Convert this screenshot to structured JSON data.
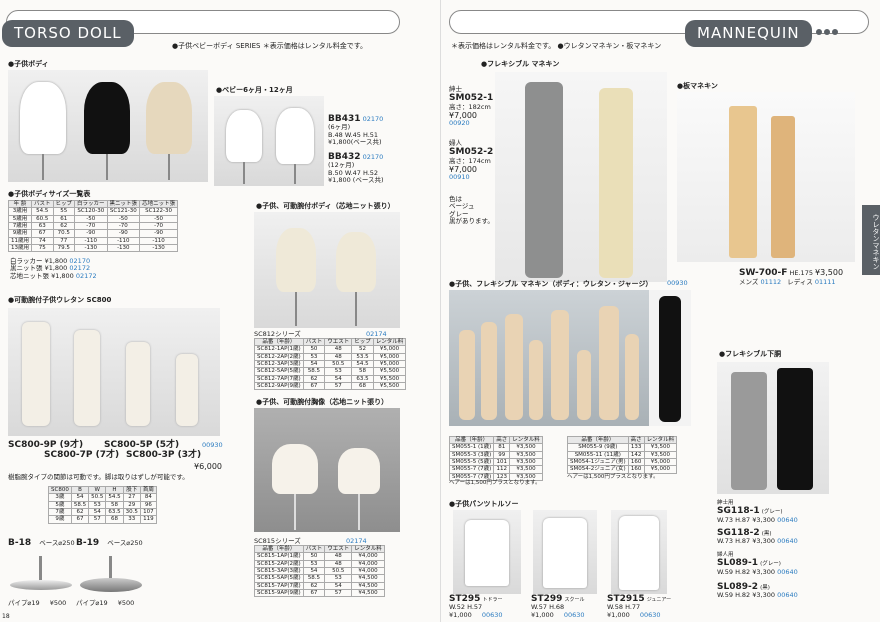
{
  "left": {
    "header": {
      "title": "TORSO DOLL",
      "subtitle": "●子供ベビーボディ SERIES ＊表示価格はレンタル料金です。"
    },
    "kids_body": {
      "title": "●子供ボディ"
    },
    "baby": {
      "title": "●ベビー6ヶ月・12ヶ月",
      "items": [
        {
          "code": "BB431",
          "num": "02170",
          "size": "(6ヶ月)",
          "dims": "B.48 W.45 H.51",
          "price": "¥1,800(ベース共)"
        },
        {
          "code": "BB432",
          "num": "02170",
          "size": "(12ヶ月)",
          "dims": "B.50 W.47 H.52",
          "price": "¥1,800 (ベース共)"
        }
      ]
    },
    "size_table": {
      "title": "●子供ボディサイズ一覧表",
      "headers": [
        "年 齢",
        "バスト",
        "ヒップ",
        "白ラッカー",
        "黒ニット張",
        "芯地ニット張"
      ],
      "rows": [
        [
          "3歳用",
          "54.5",
          "55",
          "SC120-30",
          "SC121-30",
          "SC122-30"
        ],
        [
          "5歳用",
          "60.5",
          "61",
          "-50",
          "-50",
          "-50"
        ],
        [
          "7歳用",
          "63",
          "62",
          "-70",
          "-70",
          "-70"
        ],
        [
          "9歳用",
          "67",
          "70.5",
          "-90",
          "-90",
          "-90"
        ],
        [
          "11歳用",
          "74",
          "77",
          "-110",
          "-110",
          "-110"
        ],
        [
          "13歳用",
          "75",
          "79.5",
          "-130",
          "-130",
          "-130"
        ]
      ],
      "prices": [
        {
          "label": "白ラッカー",
          "price": "¥1,800",
          "num": "02170"
        },
        {
          "label": "黒ニット張",
          "price": "¥1,800",
          "num": "02172"
        },
        {
          "label": "芯地ニット張",
          "price": "¥1,800",
          "num": "02172"
        }
      ]
    },
    "sc800": {
      "title": "●可動腕付子供ウレタン SC800",
      "labels": [
        "SC800-9P (9才)",
        "SC800-7P (7才)",
        "SC800-5P (5才)",
        "SC800-3P (3才)"
      ],
      "num": "00930",
      "price": "¥6,000",
      "note": "樹脂腕タイプの関節は可動です。脚は取りはずしが可能です。",
      "headers": [
        "SC800",
        "B",
        "W",
        "H",
        "股下",
        "首周"
      ],
      "rows": [
        [
          "3歳",
          "54",
          "50.5",
          "54.5",
          "27",
          "84"
        ],
        [
          "5歳",
          "58.5",
          "53",
          "58",
          "29",
          "96"
        ],
        [
          "7歳",
          "62",
          "54",
          "63.5",
          "30.5",
          "107"
        ],
        [
          "9歳",
          "67",
          "57",
          "68",
          "33",
          "119"
        ]
      ]
    },
    "bases": [
      {
        "code": "B-18",
        "note": "ベース⌀250",
        "pipe": "パイプ⌀19",
        "price": "¥500"
      },
      {
        "code": "B-19",
        "note": "ベース⌀250",
        "pipe": "パイプ⌀19",
        "price": "¥500"
      }
    ],
    "sc812": {
      "title": "●子供、可動腕付ボディ（芯地ニット張り）",
      "series": "SC812シリーズ",
      "num": "02174",
      "headers": [
        "品番（年齢）",
        "バスト",
        "ウエスト",
        "ヒップ",
        "レンタル料"
      ],
      "rows": [
        [
          "SC812-1AP(1歳)",
          "50",
          "48",
          "52",
          "¥5,000"
        ],
        [
          "SC812-2AP(2歳)",
          "53",
          "48",
          "53.5",
          "¥5,000"
        ],
        [
          "SC812-3AP(3歳)",
          "54",
          "50.5",
          "54.5",
          "¥5,000"
        ],
        [
          "SC812-5AP(5歳)",
          "58.5",
          "53",
          "58",
          "¥5,500"
        ],
        [
          "SC812-7AP(7歳)",
          "62",
          "54",
          "63.5",
          "¥5,500"
        ],
        [
          "SC812-9AP(9歳)",
          "67",
          "57",
          "68",
          "¥5,500"
        ]
      ]
    },
    "sc815": {
      "title": "●子供、可動腕付胸像（芯地ニット張り）",
      "series": "SC815シリーズ",
      "num": "02174",
      "headers": [
        "品番（年齢）",
        "バスト",
        "ウエスト",
        "レンタル料"
      ],
      "rows": [
        [
          "SC815-1AP(1歳)",
          "50",
          "48",
          "¥4,000"
        ],
        [
          "SC815-2AP(2歳)",
          "53",
          "48",
          "¥4,000"
        ],
        [
          "SC815-3AP(3歳)",
          "54",
          "50.5",
          "¥4,000"
        ],
        [
          "SC815-5AP(5歳)",
          "58.5",
          "53",
          "¥4,500"
        ],
        [
          "SC815-7AP(7歳)",
          "62",
          "54",
          "¥4,500"
        ],
        [
          "SC815-9AP(9歳)",
          "67",
          "57",
          "¥4,500"
        ]
      ]
    },
    "page_no": "18"
  },
  "right": {
    "header": {
      "title": "MANNEQUIN",
      "subtitle": "＊表示価格はレンタル料金です。 ●ウレタンマネキン・板マネキン"
    },
    "flexible": {
      "title": "●フレキシブル マネキン",
      "items": [
        {
          "type": "紳士",
          "code": "SM052-1",
          "height": "高さ：182cm",
          "price": "¥7,000",
          "num": "00920"
        },
        {
          "type": "婦人",
          "code": "SM052-2",
          "height": "高さ：174cm",
          "price": "¥7,000",
          "num": "00910"
        }
      ],
      "colors": [
        "色は",
        "ベージュ",
        "グレー",
        "黒があります。"
      ]
    },
    "board": {
      "title": "●板マネキン",
      "code": "SW-700-F",
      "height": "HE.175",
      "price": "¥3,500",
      "mens": "メンズ",
      "mens_num": "01112",
      "ladies": "レディス",
      "ladies_num": "01111"
    },
    "side_tab": "ウレタンマネキン",
    "kids_flex": {
      "title": "●子供、フレキシブル マネキン（ボディ：ウレタン・ジャージ）",
      "num": "00930",
      "t1_headers": [
        "品番（年齢）",
        "高さ",
        "レンタル料"
      ],
      "t1_rows": [
        [
          "SM055-1 (1歳)",
          "81",
          "¥3,500"
        ],
        [
          "SM055-3 (3歳)",
          "99",
          "¥3,500"
        ],
        [
          "SM055-5 (5歳)",
          "101",
          "¥3,500"
        ],
        [
          "SM055-7 (7歳)",
          "112",
          "¥3,500"
        ],
        [
          "SM055-7 (7歳)",
          "123",
          "¥3,500"
        ]
      ],
      "t1_note": "ヘアーは1,500円プラスとなります。",
      "t2_headers": [
        "品番（年齢）",
        "高さ",
        "レンタル料"
      ],
      "t2_rows": [
        [
          "SM055-9 (9歳)",
          "133",
          "¥3,500"
        ],
        [
          "SM055-11 (11歳)",
          "142",
          "¥3,500"
        ],
        [
          "SM054-1ジュニア(男)",
          "160",
          "¥5,000"
        ],
        [
          "SM054-2ジュニア(女)",
          "160",
          "¥5,000"
        ]
      ],
      "t2_note": "ヘアーは1,500円プラスとなります。"
    },
    "pants": {
      "title": "●子供パンツトルソー",
      "items": [
        {
          "code": "ST295",
          "sub": "トドラー",
          "dims": "W.52 H.57",
          "price": "¥1,000",
          "num": "00630"
        },
        {
          "code": "ST299",
          "sub": "スクール",
          "dims": "W.57 H.68",
          "price": "¥1,000",
          "num": "00630"
        },
        {
          "code": "ST2915",
          "sub": "ジュニアー",
          "dims": "W.58 H.77",
          "price": "¥1,000",
          "num": "00630"
        }
      ]
    },
    "lower": {
      "title": "●フレキシブル下胴",
      "items": [
        {
          "type": "紳士用",
          "code": "SG118-1",
          "color": "(グレー)",
          "dims": "W.73 H.87",
          "price": "¥3,300",
          "num": "00640"
        },
        {
          "type": "",
          "code": "SG118-2",
          "color": "(黒)",
          "dims": "W.73 H.87",
          "price": "¥3,300",
          "num": "00640"
        },
        {
          "type": "婦人用",
          "code": "SL089-1",
          "color": "(グレー)",
          "dims": "W.59 H.82",
          "price": "¥3,300",
          "num": "00640"
        },
        {
          "type": "",
          "code": "SL089-2",
          "color": "(黒)",
          "dims": "W.59 H.82",
          "price": "¥3,300",
          "num": "00640"
        }
      ]
    }
  }
}
